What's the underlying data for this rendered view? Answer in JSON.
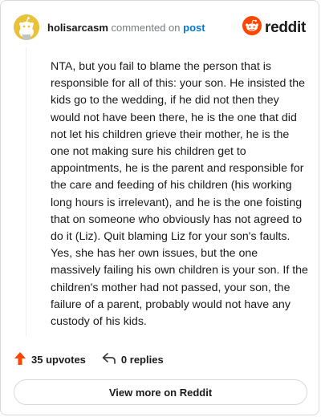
{
  "header": {
    "username": "holisarcasm",
    "verb": "commented on",
    "post_link": "post",
    "brand": "reddit"
  },
  "comment": {
    "text": "NTA, but you fail to blame the person that is responsible for all of this: your son. He insisted the kids go to the wedding, if he did not then they would not have been there, he is the one that did not let his children grieve their mother, he is the one not making sure his children get to appointments, he is the parent and responsible for the care and feeding of his children (his working long hours is irrelevant), and he is the one foisting that on someone who obviously has not agreed to do it (Liz). Quit blaming Liz for your son's faults. Yes, she has her own issues, but the one massively failing his own children is your son. If the children's mother had not passed, your son, the failure of a parent, probably would not have any custody of his kids."
  },
  "actions": {
    "upvotes": "35 upvotes",
    "replies": "0 replies"
  },
  "footer": {
    "view_more": "View more on Reddit"
  },
  "colors": {
    "upvote": "#ff4500",
    "link": "#0079d3",
    "avatar_bg": "#e9c23a",
    "reddit_orange": "#ff4500"
  },
  "icons": {
    "avatar": "snoo-avatar-icon",
    "brand": "reddit-logo-icon",
    "upvote": "upvote-arrow-icon",
    "reply": "reply-arrow-icon"
  }
}
